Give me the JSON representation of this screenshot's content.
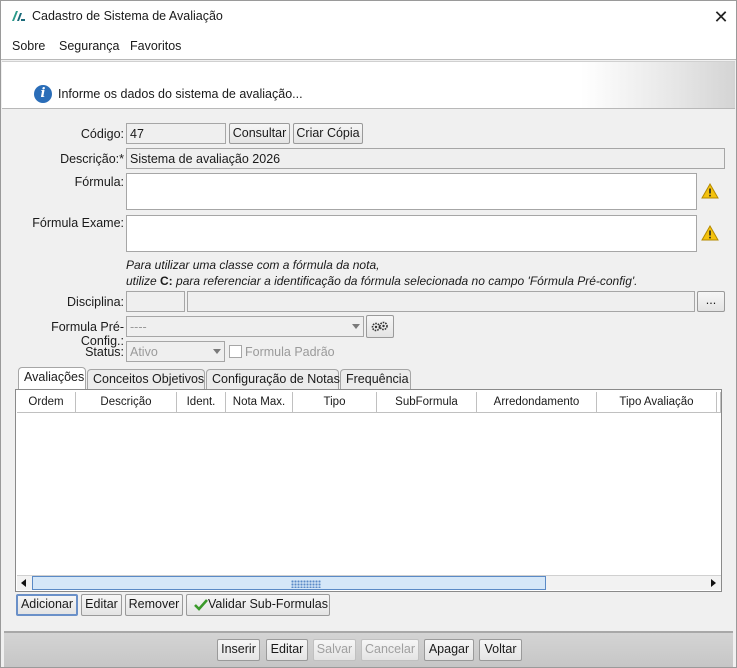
{
  "window": {
    "title": "Cadastro de Sistema de Avaliação",
    "close": "✕"
  },
  "menu": {
    "sobre": "Sobre",
    "seguranca": "Segurança",
    "favoritos": "Favoritos"
  },
  "banner": {
    "message": "Informe os dados do sistema de avaliação...",
    "icon": "i"
  },
  "form": {
    "codigo_label": "Código:",
    "codigo_value": "47",
    "consultar": "Consultar",
    "criar_copia": "Criar Cópia",
    "descricao_label": "Descrição:*",
    "descricao_value": "Sistema de avaliação 2026",
    "formula_label": "Fórmula:",
    "formula_value": "",
    "formula_exame_label": "Fórmula Exame:",
    "formula_exame_value": "",
    "hint_line1": "Para utilizar uma classe com a fórmula da nota,",
    "hint_line2_prefix": "utilize ",
    "hint_line2_bold": "C:",
    "hint_line2_suffix": " para referenciar a identificação da fórmula selecionada no campo 'Fórmula Pré-config'.",
    "disciplina_label": "Disciplina:",
    "disciplina_code": "",
    "disciplina_name": "",
    "disciplina_browse": "...",
    "formula_preconfig_label": "Formula Pré-Config.:",
    "formula_preconfig_value": "----",
    "status_label": "Status:",
    "status_value": "Ativo",
    "formula_padrao_label": "Formula Padrão"
  },
  "tabs": [
    "Avaliações",
    "Conceitos Objetivos",
    "Configuração de Notas",
    "Frequência"
  ],
  "table": {
    "columns": [
      "Ordem",
      "Descrição",
      "Ident.",
      "Nota Max.",
      "Tipo",
      "SubFormula",
      "Arredondamento",
      "Tipo Avaliação"
    ],
    "rows": []
  },
  "table_actions": {
    "adicionar": "Adicionar",
    "editar": "Editar",
    "remover": "Remover",
    "validar": "Validar Sub-Formulas"
  },
  "footer": {
    "inserir": "Inserir",
    "editar": "Editar",
    "salvar": "Salvar",
    "cancelar": "Cancelar",
    "apagar": "Apagar",
    "voltar": "Voltar"
  },
  "colors": {
    "accent": "#2a6db8",
    "warning": "#e8b100",
    "scroll_thumb": "#d5e7f8",
    "validate_check": "#3a9a2a"
  },
  "icons": {
    "logo": "app-logo-icon",
    "info": "info-icon",
    "warning": "warning-icon",
    "gears": "gears-icon",
    "check": "check-icon"
  }
}
